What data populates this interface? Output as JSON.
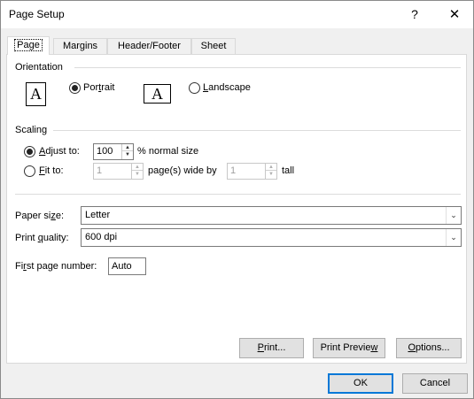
{
  "window": {
    "title": "Page Setup",
    "help_glyph": "?",
    "close_glyph": "✕"
  },
  "tabs": [
    {
      "label": "Page"
    },
    {
      "label": "Margins"
    },
    {
      "label": "Header/Footer"
    },
    {
      "label": "Sheet"
    }
  ],
  "orientation": {
    "label": "Orientation",
    "portrait_pre": "Por",
    "portrait_u": "t",
    "portrait_post": "rait",
    "landscape_u": "L",
    "landscape_post": "andscape",
    "icon_letter": "A",
    "selected": "portrait"
  },
  "scaling": {
    "label": "Scaling",
    "adjust_u": "A",
    "adjust_post": "djust to:",
    "adjust_value": "100",
    "adjust_suffix": "% normal size",
    "fit_u": "F",
    "fit_post": "it to:",
    "fit_wide_value": "1",
    "wide_label": "page(s) wide by",
    "fit_tall_value": "1",
    "tall_label": "tall",
    "selected": "adjust"
  },
  "paper_size": {
    "pre": "Paper si",
    "u": "z",
    "post": "e:",
    "value": "Letter"
  },
  "print_quality": {
    "pre": "Print ",
    "u": "q",
    "post": "uality:",
    "value": "600 dpi"
  },
  "first_page": {
    "pre": "Fi",
    "u": "r",
    "post": "st page number:",
    "value": "Auto"
  },
  "buttons": {
    "print_u": "P",
    "print_post": "rint...",
    "preview_pre": "Print Previe",
    "preview_u": "w",
    "options_u": "O",
    "options_post": "ptions...",
    "ok": "OK",
    "cancel": "Cancel"
  }
}
